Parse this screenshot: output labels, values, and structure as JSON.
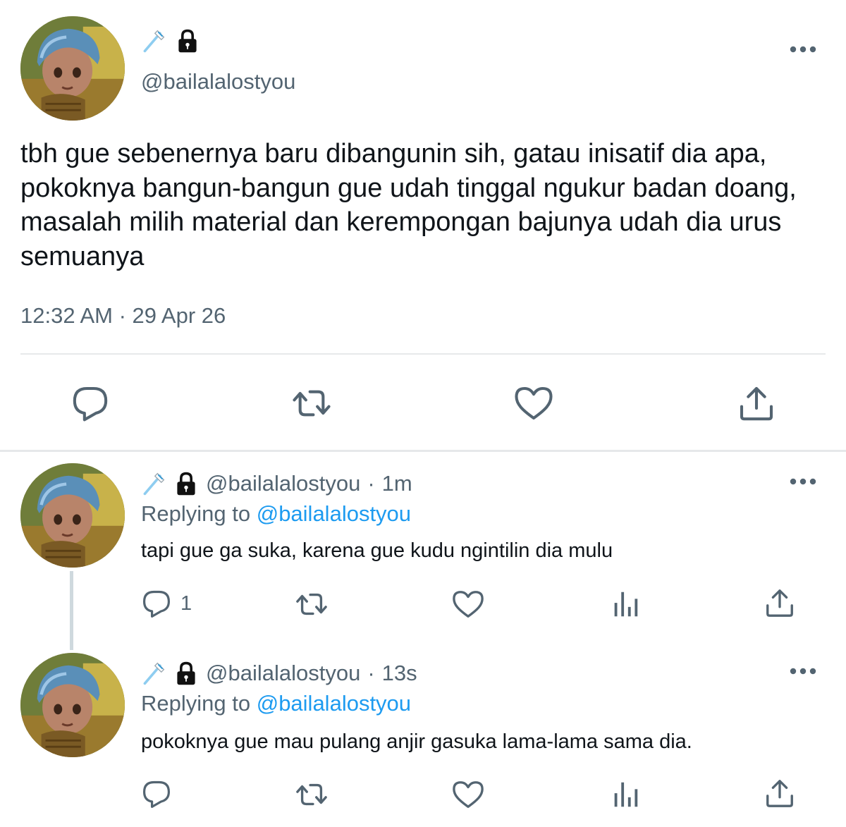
{
  "main_tweet": {
    "handle": "@bailalalostyou",
    "text": "tbh gue sebenernya baru dibangunin sih, gatau inisatif dia apa, pokoknya bangun-bangun gue udah tinggal ngukur badan doang, masalah milih material dan kerempongan bajunya udah dia urus semuanya",
    "timestamp": "12:32 AM · 29 Apr 26",
    "actions": [
      "reply-icon",
      "retweet-icon",
      "like-icon",
      "share-icon"
    ]
  },
  "replies": [
    {
      "handle": "@bailalalostyou",
      "separator": "·",
      "time": "1m",
      "replying_prefix": "Replying to",
      "replying_to": "@bailalalostyou",
      "text": "tapi gue ga suka, karena gue kudu ngintilin dia mulu",
      "reply_count": "1"
    },
    {
      "handle": "@bailalalostyou",
      "separator": "·",
      "time": "13s",
      "replying_prefix": "Replying to",
      "replying_to": "@bailalalostyou",
      "text": "pokoknya gue mau pulang anjir gasuka lama-lama sama dia.",
      "reply_count": ""
    }
  ],
  "display_name_icons": [
    "toothbrush-icon",
    "lock-icon"
  ],
  "colors": {
    "text": "#0f1419",
    "secondary": "#536471",
    "link": "#1d9bf0",
    "divider": "#e7e9ea"
  }
}
